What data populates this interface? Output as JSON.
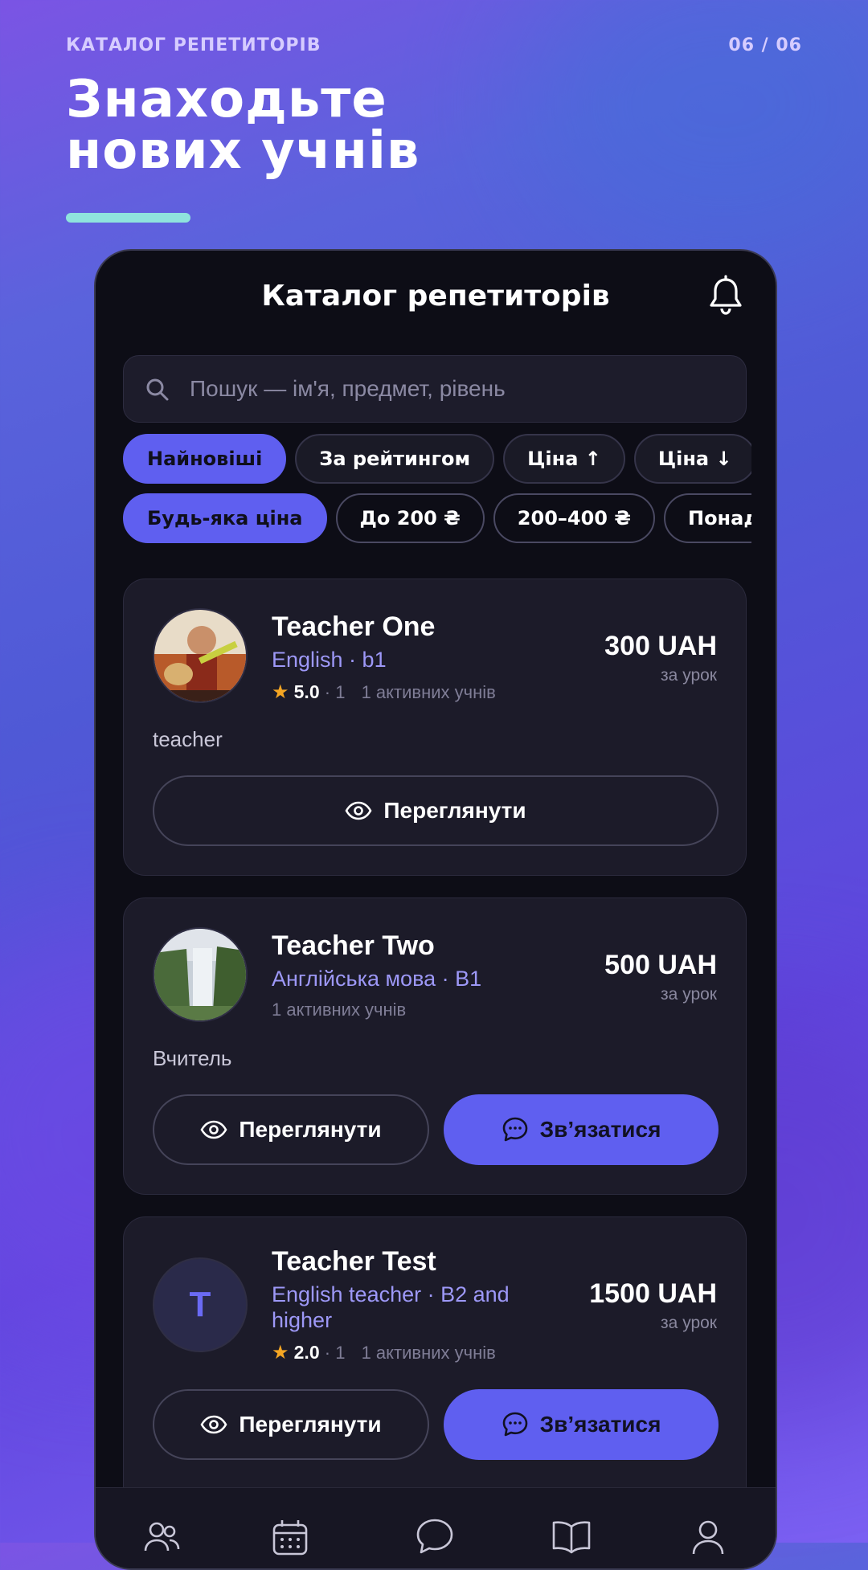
{
  "promo": {
    "kicker": "КАТАЛОГ РЕПЕТИТОРІВ",
    "counter": "06 / 06",
    "headline_line1": "Знаходьте",
    "headline_line2": "нових учнів"
  },
  "app": {
    "title": "Каталог репетиторів",
    "search_placeholder": "Пошук — ім'я, предмет, рівень"
  },
  "sort_chips": [
    {
      "label": "Найновіші",
      "active": true
    },
    {
      "label": "За рейтингом",
      "active": false
    },
    {
      "label": "Ціна ↑",
      "active": false
    },
    {
      "label": "Ціна ↓",
      "active": false
    }
  ],
  "price_chips": [
    {
      "label": "Будь-яка ціна",
      "active": true
    },
    {
      "label": "До 200 ₴",
      "active": false
    },
    {
      "label": "200–400 ₴",
      "active": false
    },
    {
      "label": "Понад",
      "active": false
    }
  ],
  "teachers": [
    {
      "name": "Teacher One",
      "subject": "English · b1",
      "rating": "5.0",
      "reviews": "1",
      "students": "1 активних учнів",
      "price": "300 UAH",
      "per": "за урок",
      "bio": "teacher",
      "view_label": "Переглянути",
      "contact_label": ""
    },
    {
      "name": "Teacher Two",
      "subject": "Англійська мова · B1",
      "students": "1 активних учнів",
      "price": "500 UAH",
      "per": "за урок",
      "bio": "Вчитель",
      "view_label": "Переглянути",
      "contact_label": "Зв’язатися"
    },
    {
      "name": "Teacher Test",
      "avatar_letter": "T",
      "subject": "English teacher · B2 and higher",
      "rating": "2.0",
      "reviews": "1",
      "students": "1 активних учнів",
      "price": "1500 UAH",
      "per": "за урок",
      "view_label": "Переглянути",
      "contact_label": "Зв’язатися"
    }
  ],
  "colors": {
    "accent": "#5f5ff0",
    "subject": "#9d98f7",
    "star": "#f5a623",
    "background": "#0d0d16",
    "card": "#1c1b29",
    "headline_bar": "#8fe3dd"
  },
  "icons": {
    "bell": "bell-icon",
    "search": "search-icon",
    "view": "eye-icon",
    "contact": "chat-bubble-icon",
    "nav": [
      "users-icon",
      "calendar-icon",
      "chat-icon",
      "book-icon",
      "profile-icon"
    ]
  }
}
